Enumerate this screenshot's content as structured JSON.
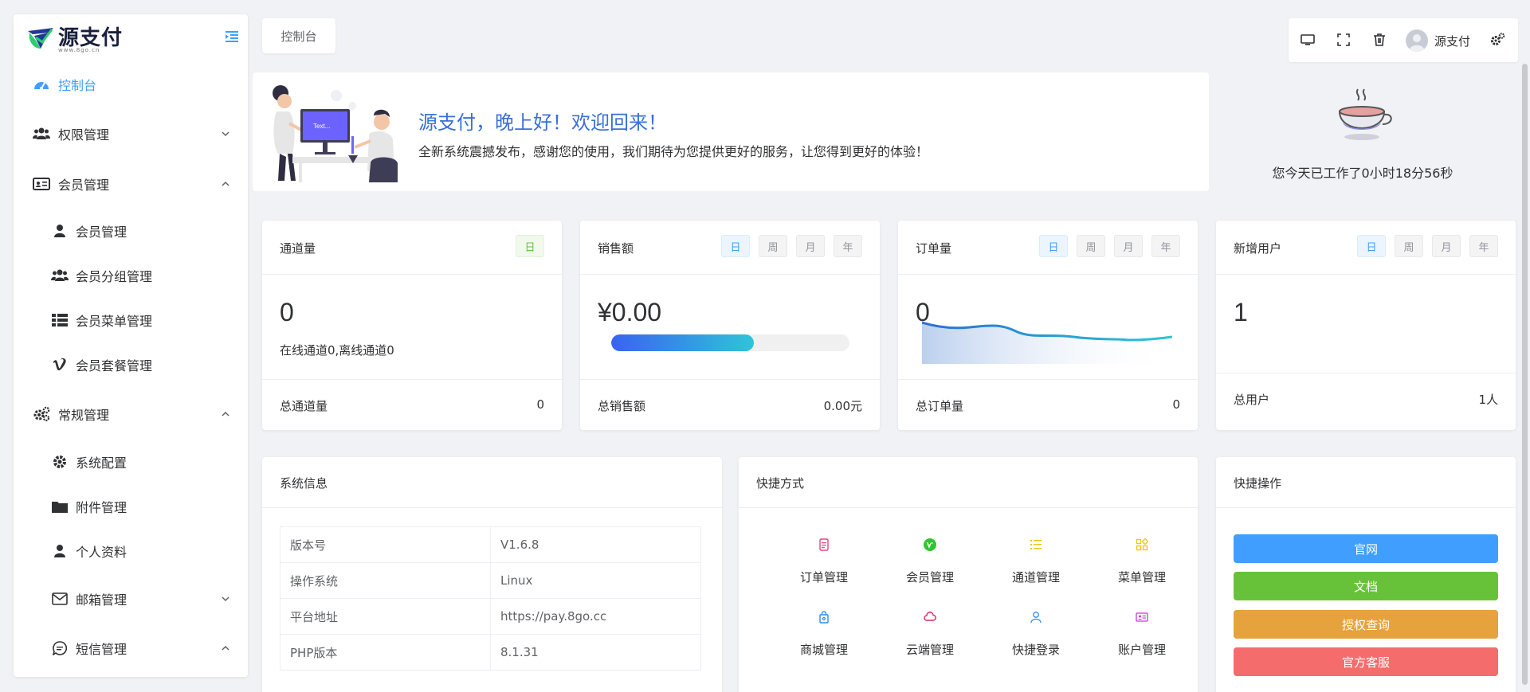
{
  "brand": {
    "name": "源支付",
    "sub": "www.8go.cn"
  },
  "sidebar": {
    "items": [
      {
        "label": "控制台",
        "icon": "dashboard-icon"
      },
      {
        "label": "权限管理",
        "icon": "users-icon"
      },
      {
        "label": "会员管理",
        "icon": "id-card-icon"
      },
      {
        "label": "会员管理",
        "icon": "user-icon"
      },
      {
        "label": "会员分组管理",
        "icon": "users-icon"
      },
      {
        "label": "会员菜单管理",
        "icon": "list-icon"
      },
      {
        "label": "会员套餐管理",
        "icon": "vimeo-icon"
      },
      {
        "label": "常规管理",
        "icon": "cogs-icon"
      },
      {
        "label": "系统配置",
        "icon": "gear-icon"
      },
      {
        "label": "附件管理",
        "icon": "folder-icon"
      },
      {
        "label": "个人资料",
        "icon": "user-icon"
      },
      {
        "label": "邮箱管理",
        "icon": "mail-icon"
      },
      {
        "label": "短信管理",
        "icon": "message-icon"
      }
    ]
  },
  "breadcrumb": {
    "tab": "控制台"
  },
  "topbar": {
    "username": "源支付"
  },
  "welcome": {
    "title": "源支付，晚上好！欢迎回来！",
    "desc": "全新系统震撼发布，感谢您的使用，我们期待为您提供更好的服务，让您得到更好的体验！"
  },
  "worktime": {
    "text": "您今天已工作了0小时18分56秒"
  },
  "periods": {
    "day": "日",
    "week": "周",
    "month": "月",
    "year": "年"
  },
  "stats": {
    "channel": {
      "title": "通道量",
      "value": "0",
      "sub": "在线通道0,离线通道0",
      "foot_label": "总通道量",
      "foot_value": "0"
    },
    "sales": {
      "title": "销售额",
      "value": "¥0.00",
      "progress": 0.6,
      "foot_label": "总销售额",
      "foot_value": "0.00元"
    },
    "orders": {
      "title": "订单量",
      "value": "0",
      "foot_label": "总订单量",
      "foot_value": "0"
    },
    "users": {
      "title": "新增用户",
      "value": "1",
      "foot_label": "总用户",
      "foot_value": "1人"
    }
  },
  "sysinfo": {
    "title": "系统信息",
    "rows": [
      {
        "k": "版本号",
        "v": "V1.6.8"
      },
      {
        "k": "操作系统",
        "v": "Linux"
      },
      {
        "k": "平台地址",
        "v": "https://pay.8go.cc"
      },
      {
        "k": "PHP版本",
        "v": "8.1.31"
      }
    ]
  },
  "shortcuts": {
    "title": "快捷方式",
    "items": [
      {
        "label": "订单管理",
        "icon": "order-icon",
        "color": "#e6457a"
      },
      {
        "label": "会员管理",
        "icon": "vip-icon",
        "color": "#2fc62f"
      },
      {
        "label": "通道管理",
        "icon": "channel-list-icon",
        "color": "#f0c419"
      },
      {
        "label": "菜单管理",
        "icon": "menu-grid-icon",
        "color": "#f0c419"
      },
      {
        "label": "商城管理",
        "icon": "shop-icon",
        "color": "#2d8cf0"
      },
      {
        "label": "云端管理",
        "icon": "cloud-icon",
        "color": "#e0245e"
      },
      {
        "label": "快捷登录",
        "icon": "login-user-icon",
        "color": "#2d8cf0"
      },
      {
        "label": "账户管理",
        "icon": "account-card-icon",
        "color": "#c03cd8"
      }
    ]
  },
  "quick_actions": {
    "title": "快捷操作",
    "buttons": [
      {
        "label": "官网",
        "color": "#409eff"
      },
      {
        "label": "文档",
        "color": "#67c23a"
      },
      {
        "label": "授权查询",
        "color": "#e6a23c"
      },
      {
        "label": "官方客服",
        "color": "#f56c6c"
      }
    ]
  }
}
